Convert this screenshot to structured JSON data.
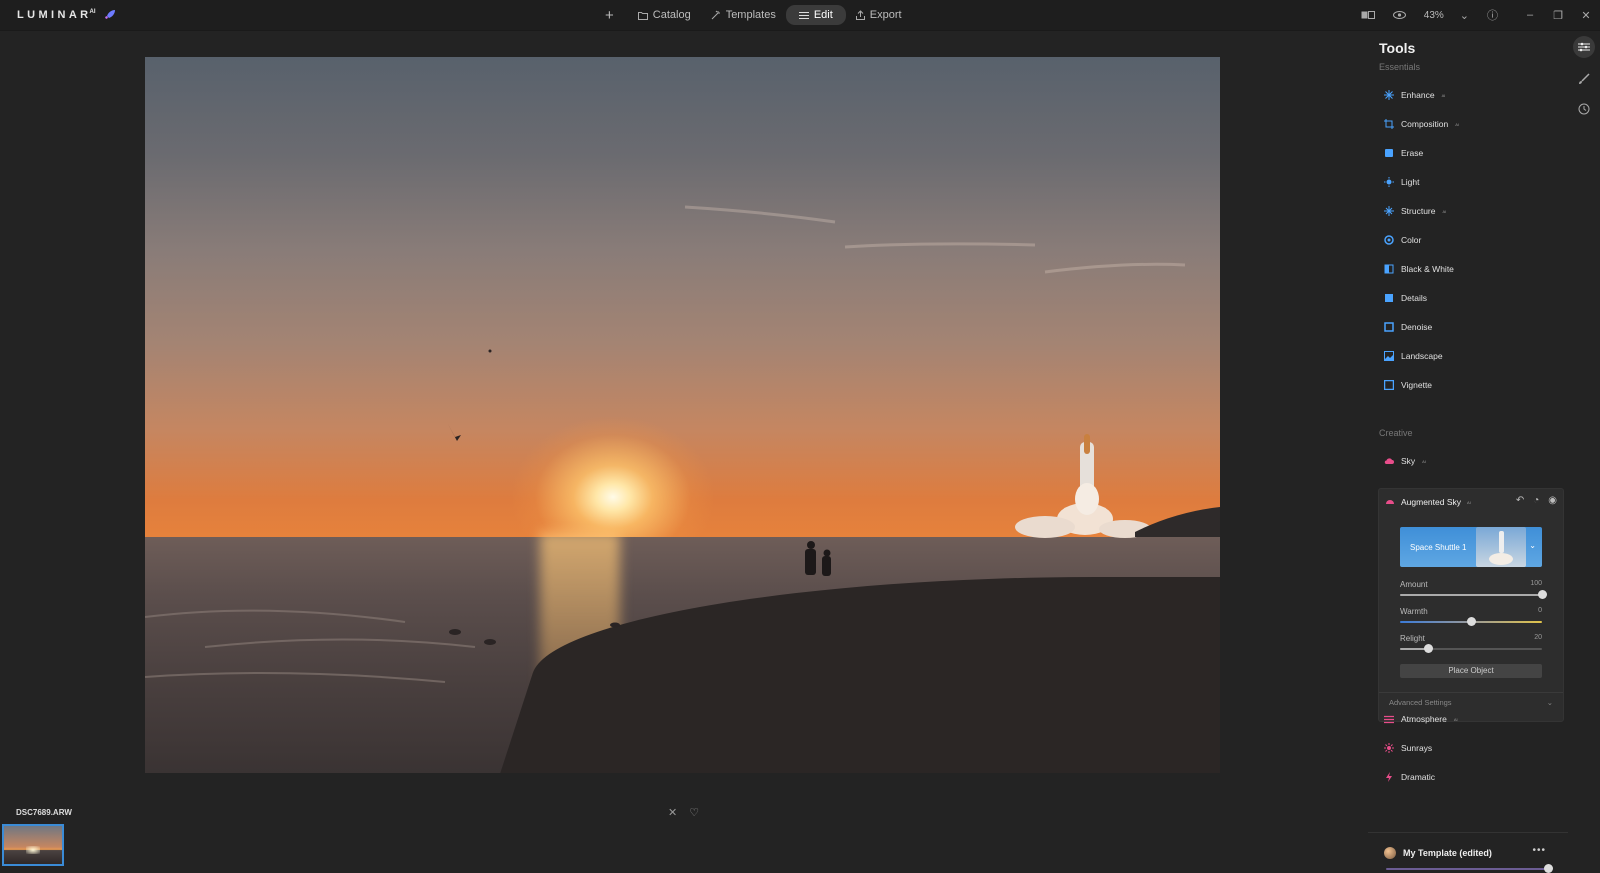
{
  "app": {
    "name": "LUMINAR",
    "superscript": "AI"
  },
  "nav": {
    "add_label": "+",
    "items": [
      {
        "label": "Catalog",
        "icon": "folder-icon"
      },
      {
        "label": "Templates",
        "icon": "magic-icon"
      },
      {
        "label": "Edit",
        "icon": "sliders-icon",
        "active": true
      },
      {
        "label": "Export",
        "icon": "export-icon"
      }
    ]
  },
  "view": {
    "zoom": "43%"
  },
  "filmstrip": {
    "filename": "DSC7689.ARW"
  },
  "rating": {
    "reject": "✕",
    "favorite": "♡"
  },
  "panel": {
    "title": "Tools",
    "essentials_label": "Essentials",
    "essentials": [
      {
        "label": "Enhance",
        "ai": "AI",
        "color": "#4aa3ff"
      },
      {
        "label": "Composition",
        "ai": "AI",
        "color": "#4aa3ff"
      },
      {
        "label": "Erase",
        "ai": "",
        "color": "#4aa3ff"
      },
      {
        "label": "Light",
        "ai": "",
        "color": "#4aa3ff"
      },
      {
        "label": "Structure",
        "ai": "AI",
        "color": "#4aa3ff"
      },
      {
        "label": "Color",
        "ai": "",
        "color": "#4aa3ff"
      },
      {
        "label": "Black & White",
        "ai": "",
        "color": "#4aa3ff"
      },
      {
        "label": "Details",
        "ai": "",
        "color": "#4aa3ff"
      },
      {
        "label": "Denoise",
        "ai": "",
        "color": "#4aa3ff"
      },
      {
        "label": "Landscape",
        "ai": "",
        "color": "#4aa3ff"
      },
      {
        "label": "Vignette",
        "ai": "",
        "color": "#4aa3ff"
      }
    ],
    "creative_label": "Creative",
    "sky": {
      "label": "Sky",
      "ai": "AI"
    },
    "augmented_sky": {
      "label": "Augmented Sky",
      "ai": "AI",
      "object": "Space Shuttle 1",
      "sliders": [
        {
          "label": "Amount",
          "value": "100",
          "fraction": 1.0
        },
        {
          "label": "Warmth",
          "value": "0",
          "fraction": 0.5
        },
        {
          "label": "Relight",
          "value": "20",
          "fraction": 0.2
        }
      ],
      "place_object": "Place Object",
      "advanced": "Advanced Settings"
    },
    "creative_after": [
      {
        "label": "Atmosphere",
        "ai": "AI"
      },
      {
        "label": "Sunrays",
        "ai": ""
      },
      {
        "label": "Dramatic",
        "ai": ""
      }
    ],
    "template": {
      "label": "My Template (edited)",
      "more": "•••"
    }
  },
  "colors": {
    "accent": "#3a8bd6",
    "creative": "#e84d8a"
  }
}
